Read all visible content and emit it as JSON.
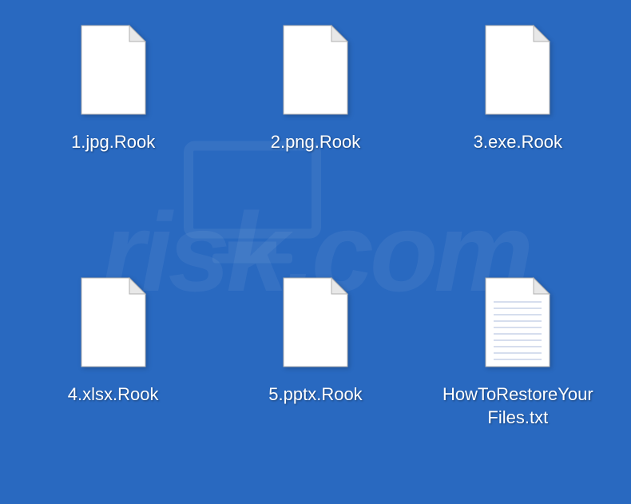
{
  "watermark": {
    "text": "risk.com"
  },
  "files": [
    {
      "name": "1.jpg.Rook",
      "type": "unknown"
    },
    {
      "name": "2.png.Rook",
      "type": "unknown"
    },
    {
      "name": "3.exe.Rook",
      "type": "unknown"
    },
    {
      "name": "4.xlsx.Rook",
      "type": "unknown"
    },
    {
      "name": "5.pptx.Rook",
      "type": "unknown"
    },
    {
      "name": "HowToRestoreYourFiles.txt",
      "type": "text"
    }
  ]
}
